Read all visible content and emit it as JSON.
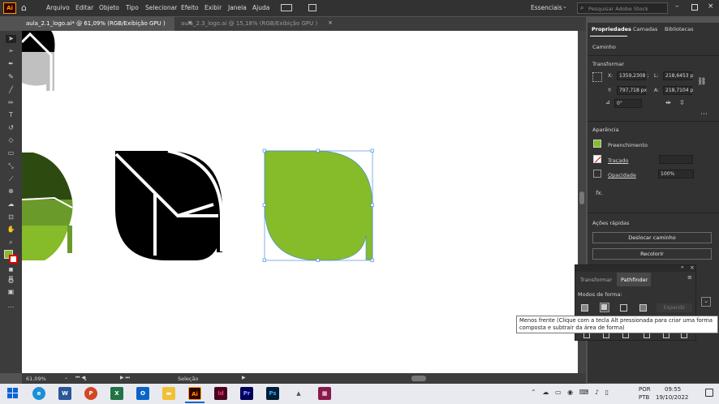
{
  "menu": [
    "Arquivo",
    "Editar",
    "Objeto",
    "Tipo",
    "Selecionar",
    "Efeito",
    "Exibir",
    "Janela",
    "Ajuda"
  ],
  "workspace": "Essenciais",
  "search_placeholder": "Pesquisar Adobe Stock",
  "tabs": [
    {
      "label": "aula_2.1_logo.ai* @ 61,09% (RGB/Exibição GPU )",
      "close": "×"
    },
    {
      "label": "aula_2.3_logo.ai @ 15,18% (RGB/Exibição GPU )",
      "close": "×"
    }
  ],
  "panel": {
    "tabs": [
      "Propriedades",
      "Camadas",
      "Bibliotecas"
    ],
    "object_type": "Caminho",
    "transform": {
      "title": "Transformar",
      "x_label": "X:",
      "x": "1359,2308 ;",
      "w_label": "L:",
      "w": "218,6453 p",
      "y_label": "Y:",
      "y": "797,718 px",
      "h_label": "A:",
      "h": "218,7104 p",
      "angle": "0°"
    },
    "appearance": {
      "title": "Aparência",
      "fill": "Preenchimento",
      "stroke": "Traçado",
      "opacity_label": "Opacidade",
      "opacity": "100%",
      "fx": "fx."
    },
    "quick_actions": {
      "title": "Ações rápidas",
      "offset_path": "Deslocar caminho",
      "recolor": "Recolorir"
    }
  },
  "pathfinder": {
    "tabs": [
      "Transformar",
      "Pathfinder"
    ],
    "shape_modes": "Modos de forma:",
    "expand": "Expandir"
  },
  "tooltip": "Menos frente (Clique com a tecla Alt pressionada para criar uma forma composta e subtrair da área de forma)",
  "status": {
    "zoom": "61,09%",
    "artboard": "1",
    "mode": "Seleção"
  },
  "taskbar": {
    "lang1": "POR",
    "lang2": "PTB",
    "time": "09:55",
    "date": "19/10/2022"
  },
  "colors": {
    "leaf_green": "#86bb29",
    "dark_green": "#2d4a10",
    "mid_green": "#6a9b2a",
    "gray": "#c0c0c0",
    "selection": "#4a90d9"
  }
}
